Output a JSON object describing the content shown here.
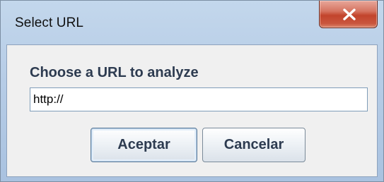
{
  "window": {
    "title": "Select URL",
    "close_icon": "close-icon"
  },
  "dialog": {
    "prompt": "Choose a URL to analyze",
    "url_value": "http://",
    "accept_label": "Aceptar",
    "cancel_label": "Cancelar"
  },
  "colors": {
    "title_bar": "#b6cce6",
    "close_button": "#c9563e",
    "content_bg": "#f0f0f0",
    "label_text": "#2d3b50"
  }
}
